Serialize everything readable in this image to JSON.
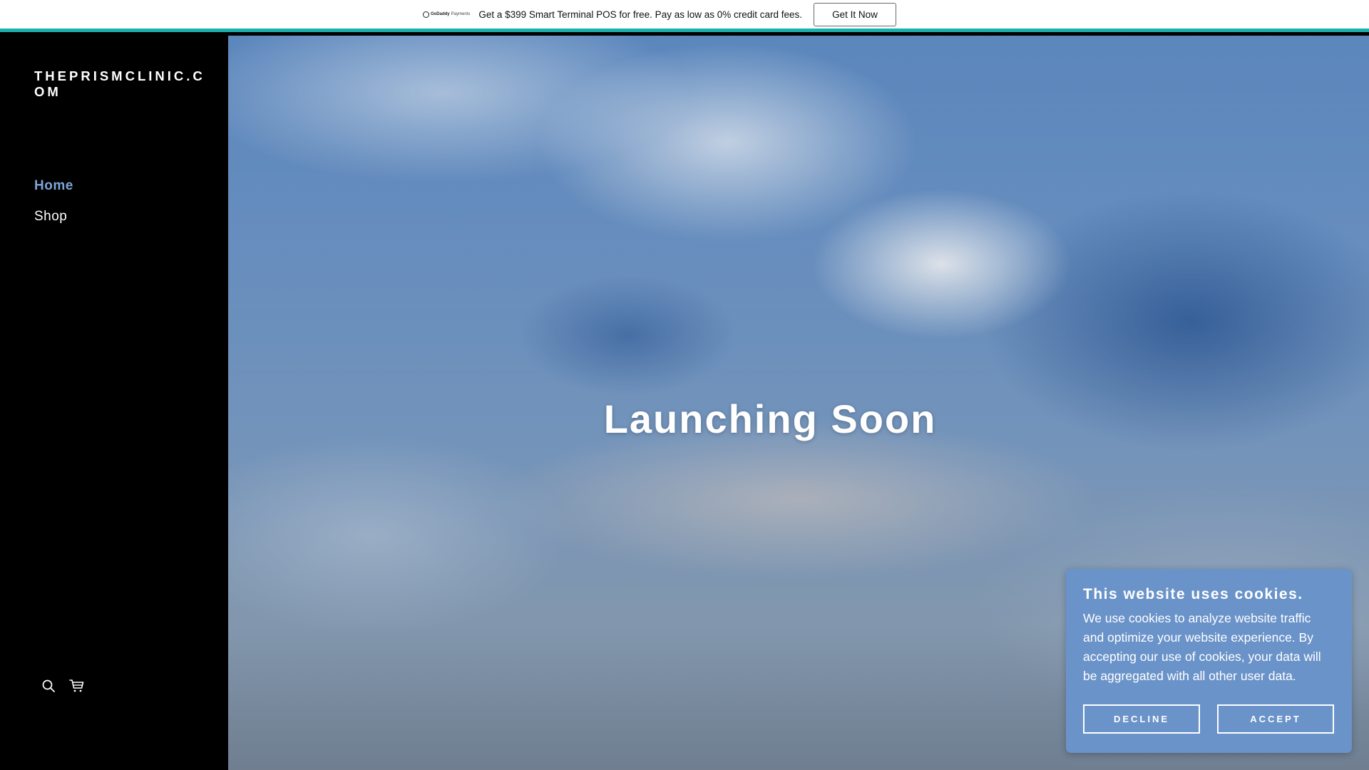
{
  "promo": {
    "logo_brand": "GoDaddy",
    "logo_sub": "Payments",
    "text": "Get a $399 Smart Terminal POS for free. Pay as low as 0% credit card fees.",
    "button_label": "Get It Now",
    "accent_color": "#1bb1b1"
  },
  "sidebar": {
    "site_title": "THEPRISMCLINIC.COM",
    "nav": [
      {
        "label": "Home",
        "active": true
      },
      {
        "label": "Shop",
        "active": false
      }
    ],
    "active_color": "#7ea4d6",
    "icons": [
      "search-icon",
      "cart-icon"
    ]
  },
  "hero": {
    "title": "Launching Soon"
  },
  "cookie": {
    "title": "This website uses cookies.",
    "body": "We use cookies to analyze website traffic and optimize your website experience. By accepting our use of cookies, your data will be aggregated with all other user data.",
    "decline_label": "DECLINE",
    "accept_label": "ACCEPT",
    "background_color": "#6a93c9"
  }
}
